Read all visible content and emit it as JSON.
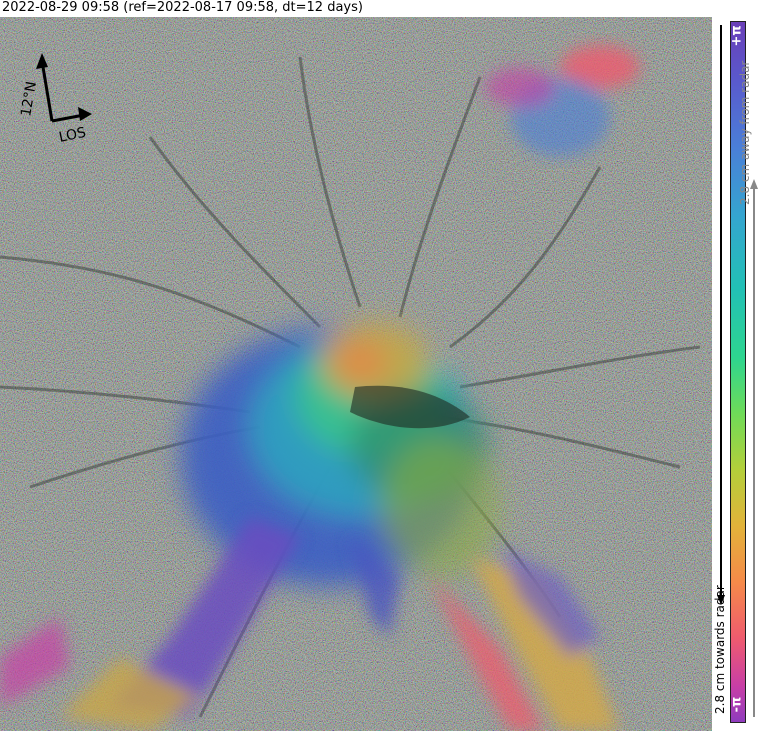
{
  "title": "2022-08-29 09:58 (ref=2022-08-17 09:58, dt=12 days)",
  "compass": {
    "north_label": "12°N",
    "los_label": "LOS"
  },
  "colorbar": {
    "top_label": "+π",
    "bottom_label": "-π",
    "away_label": "2.8 cm away from radar",
    "towards_label": "2.8 cm towards radar",
    "colors": [
      "#6a3fb8",
      "#4a7fd8",
      "#22c0b6",
      "#2ed58f",
      "#b4cf3a",
      "#f58a49",
      "#ef5b6e",
      "#8f3cbd"
    ]
  }
}
